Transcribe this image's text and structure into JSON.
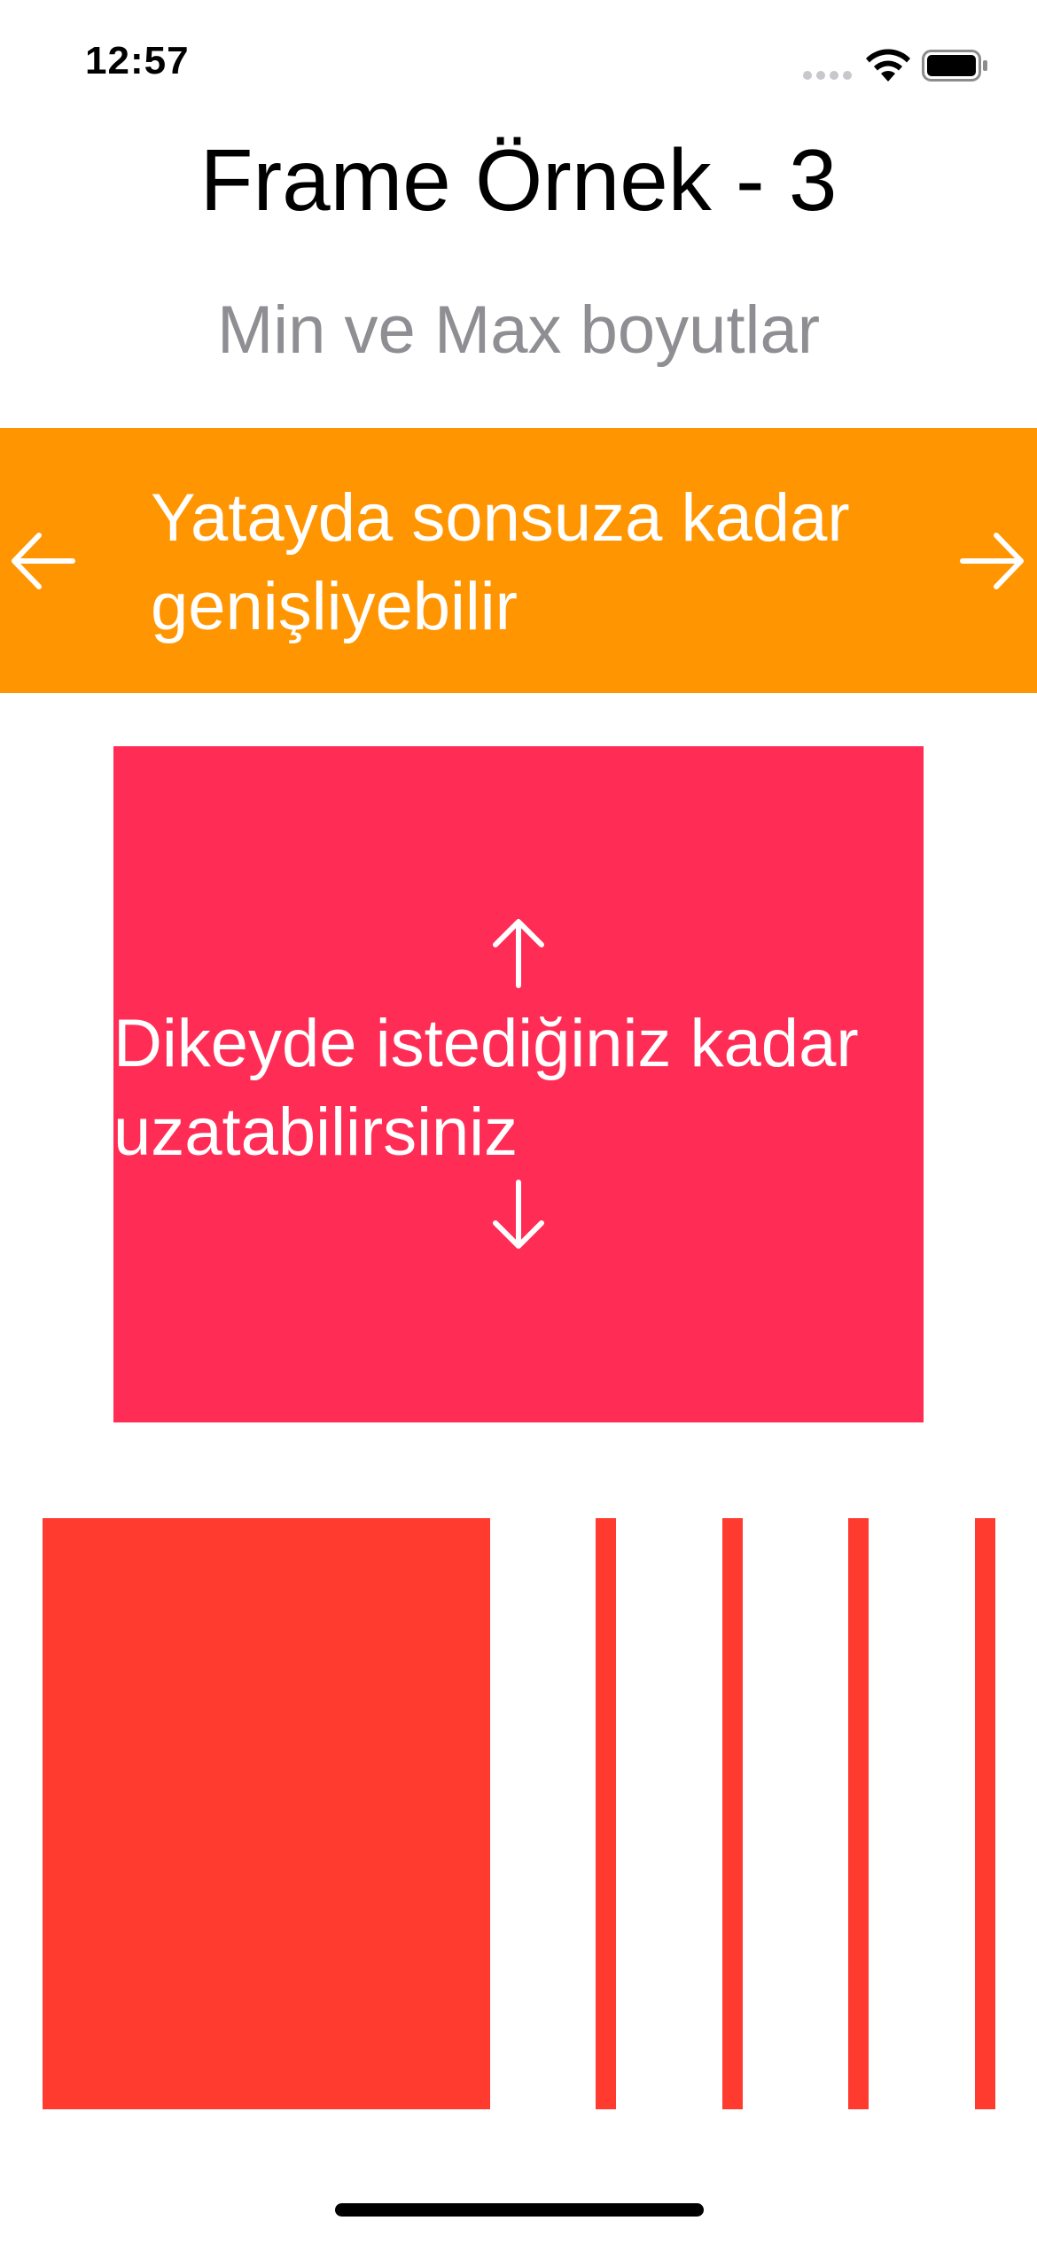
{
  "status_bar": {
    "time": "12:57",
    "icons": [
      "signal-dots-icon",
      "wifi-icon",
      "battery-icon"
    ]
  },
  "header": {
    "title": "Frame Örnek - 3",
    "subtitle": "Min ve Max boyutlar"
  },
  "horizontal_demo": {
    "text": "Yatayda sonsuza kadar genişliyebilir",
    "left_icon": "arrow-left-icon",
    "right_icon": "arrow-right-icon",
    "color": "#ff9500"
  },
  "vertical_demo": {
    "text": "Dikeyde istediğiniz kadar uzatabilirsiniz",
    "top_icon": "arrow-up-icon",
    "bottom_icon": "arrow-down-icon",
    "color": "#ff2d55"
  },
  "red_blocks": {
    "color": "#ff3b30",
    "count": 5
  },
  "colors": {
    "title": "#000000",
    "subtitle": "#8e8e93",
    "banner_text": "#ffffff"
  }
}
